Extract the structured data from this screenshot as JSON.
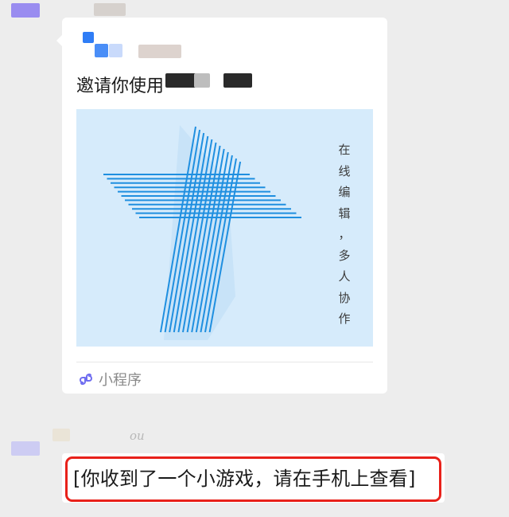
{
  "colors": {
    "background": "#ededed",
    "card": "#ffffff",
    "cover_bg": "#d6ebfb",
    "stripe": "#1f8fe0",
    "highlight_outline": "#e8211a",
    "mini_program_icon": "#6f6df0"
  },
  "messages": [
    {
      "type": "mini_program_card",
      "title": "邀请你使用",
      "cover_caption": [
        "在",
        "线",
        "编",
        "辑",
        "，",
        "多",
        "人",
        "协",
        "作"
      ],
      "footer_icon": "mini-program-link-icon",
      "footer_label": "小程序"
    },
    {
      "type": "text",
      "sender_hint": "ou",
      "text": "[你收到了一个小游戏，请在手机上查看]"
    }
  ]
}
